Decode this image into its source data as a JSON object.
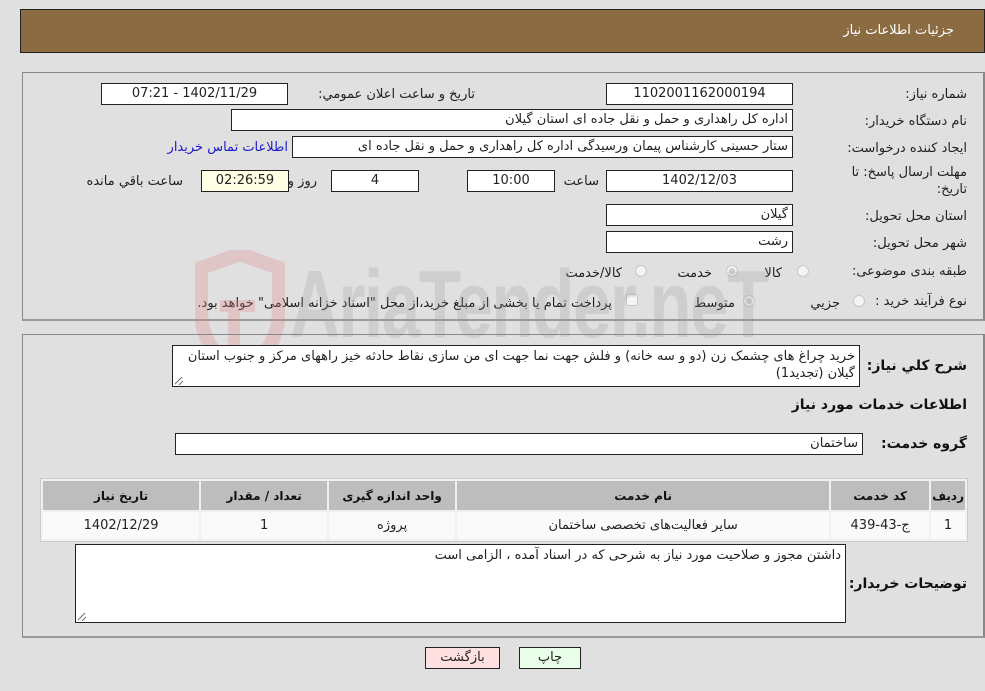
{
  "header": {
    "title": "جزئیات اطلاعات نیاز"
  },
  "details": {
    "need_number_label": "شماره نیاز:",
    "need_number": "1102001162000194",
    "announce_label": "تاریخ و ساعت اعلان عمومي:",
    "announce_value": "1402/11/29 - 07:21",
    "buyer_org_label": "نام دستگاه خریدار:",
    "buyer_org": "اداره کل راهداری و حمل و نقل جاده ای استان گیلان",
    "creator_label": "ایجاد کننده درخواست:",
    "creator": "ستار حسینی کارشناس پیمان ورسیدگی اداره کل راهداری و حمل و نقل جاده ای",
    "contact_link": "اطلاعات تماس خریدار",
    "deadline_label": "مهلت ارسال پاسخ: تا تاریخ:",
    "deadline_date": "1402/12/03",
    "time_label": "ساعت",
    "deadline_time": "10:00",
    "days_value": "4",
    "days_label": "روز و",
    "remaining_time": "02:26:59",
    "remaining_label": "ساعت باقي مانده",
    "province_label": "استان محل تحویل:",
    "province": "گیلان",
    "city_label": "شهر محل تحویل:",
    "city": "رشت",
    "category_label": "طبقه بندی موضوعی:",
    "category_options": [
      {
        "label": "کالا",
        "checked": false
      },
      {
        "label": "خدمت",
        "checked": true
      },
      {
        "label": "کالا/خدمت",
        "checked": false
      }
    ],
    "purchase_type_label": "نوع فرآیند خرید :",
    "purchase_type_options": [
      {
        "label": "جزيي",
        "checked": false
      },
      {
        "label": "متوسط",
        "checked": true
      }
    ],
    "treasury_note": "پرداخت تمام یا بخشی از مبلغ خرید،از محل \"اسناد خزانه اسلامی\" خواهد بود.",
    "treasury_checked": false
  },
  "summary": {
    "description_label": "شرح کلي نیاز:",
    "description": "خرید چراغ های چشمک زن (دو و سه خانه) و فلش جهت نما جهت ای من سازی نقاط حادثه خیز راههای مرکز و جنوب استان گیلان (تجدید1)",
    "services_heading": "اطلاعات خدمات مورد نیاز",
    "service_group_label": "گروه خدمت:",
    "service_group": "ساختمان"
  },
  "table": {
    "headers": [
      "ردیف",
      "کد خدمت",
      "نام خدمت",
      "واحد اندازه گیری",
      "تعداد / مقدار",
      "تاریخ نیاز"
    ],
    "rows": [
      [
        "1",
        "ج-43-439",
        "سایر فعالیت‌های تخصصی ساختمان",
        "پروژه",
        "1",
        "1402/12/29"
      ]
    ]
  },
  "buyer_notes": {
    "label": "توضیحات خریدار:",
    "text": "داشتن مجوز و صلاحیت مورد نیاز به شرحی که در اسناد آمده ، الزامی است"
  },
  "buttons": {
    "print": "چاپ",
    "back": "بازگشت"
  },
  "watermark": {
    "text": "AriaTender.neT"
  }
}
